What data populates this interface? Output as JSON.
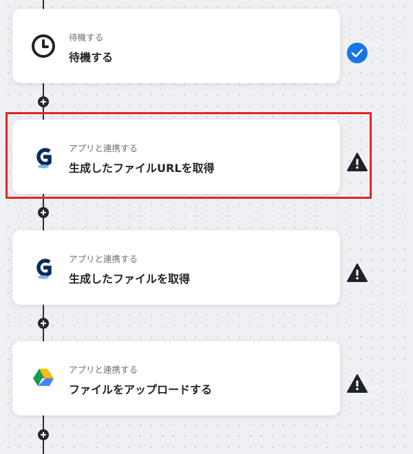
{
  "steps": [
    {
      "subtitle": "待機する",
      "title": "待機する",
      "icon": "clock-icon",
      "status": "completed-check-icon"
    },
    {
      "subtitle": "アプリと連携する",
      "title": "生成したファイルURLを取得",
      "icon": "g-app-logo-icon",
      "status": "warning-icon"
    },
    {
      "subtitle": "アプリと連携する",
      "title": "生成したファイルを取得",
      "icon": "g-app-logo-icon",
      "status": "warning-icon"
    },
    {
      "subtitle": "アプリと連携する",
      "title": "ファイルをアップロードする",
      "icon": "google-drive-icon",
      "status": "warning-icon"
    }
  ],
  "colors": {
    "check": "#1a73e8",
    "warning": "#1f2227",
    "highlight": "#e02424",
    "g_logo": "#0b2a5b",
    "g_logo_shadow": "#7fb6e6"
  }
}
